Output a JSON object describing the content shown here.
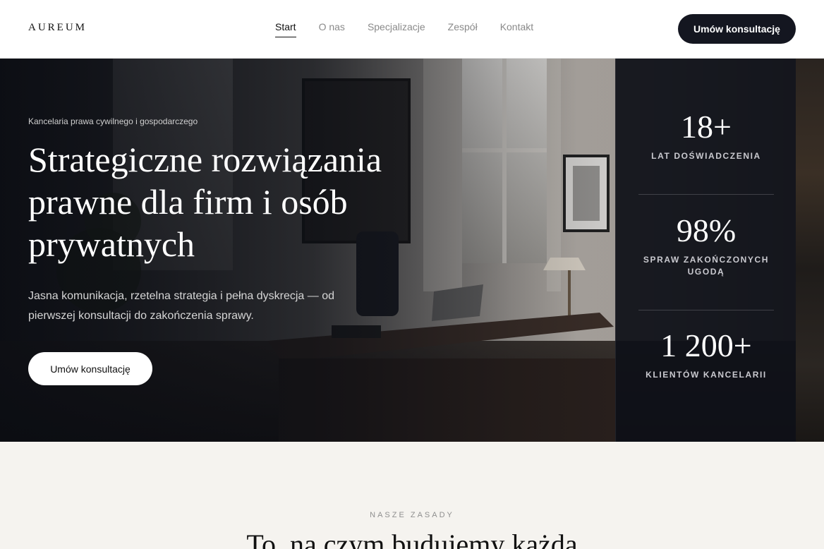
{
  "brand": {
    "logo": "AUREUM"
  },
  "nav": {
    "items": [
      {
        "label": "Start",
        "active": true
      },
      {
        "label": "O nas",
        "active": false
      },
      {
        "label": "Specjalizacje",
        "active": false
      },
      {
        "label": "Zespół",
        "active": false
      },
      {
        "label": "Kontakt",
        "active": false
      }
    ],
    "cta_label": "Umów konsultację"
  },
  "hero": {
    "eyebrow": "Kancelaria prawa cywilnego i gospodarczego",
    "title": "Strategiczne rozwiązania prawne dla firm i osób prywatnych",
    "subtitle": "Jasna komunikacja, rzetelna strategia i pełna dyskrecja — od pierwszej konsultacji do zakończenia sprawy.",
    "cta_label": "Umów konsultację"
  },
  "stats": [
    {
      "value": "18+",
      "label": "LAT DOŚWIADCZENIA"
    },
    {
      "value": "98%",
      "label": "SPRAW ZAKOŃCZONYCH UGODĄ"
    },
    {
      "value": "1 200+",
      "label": "KLIENTÓW KANCELARII"
    }
  ],
  "principles": {
    "eyebrow": "NASZE ZASADY",
    "title": "To, na czym budujemy każdą"
  },
  "colors": {
    "primary_dark": "#141620",
    "section_bg": "#f5f3ef",
    "stats_bg": "#0e1018"
  }
}
